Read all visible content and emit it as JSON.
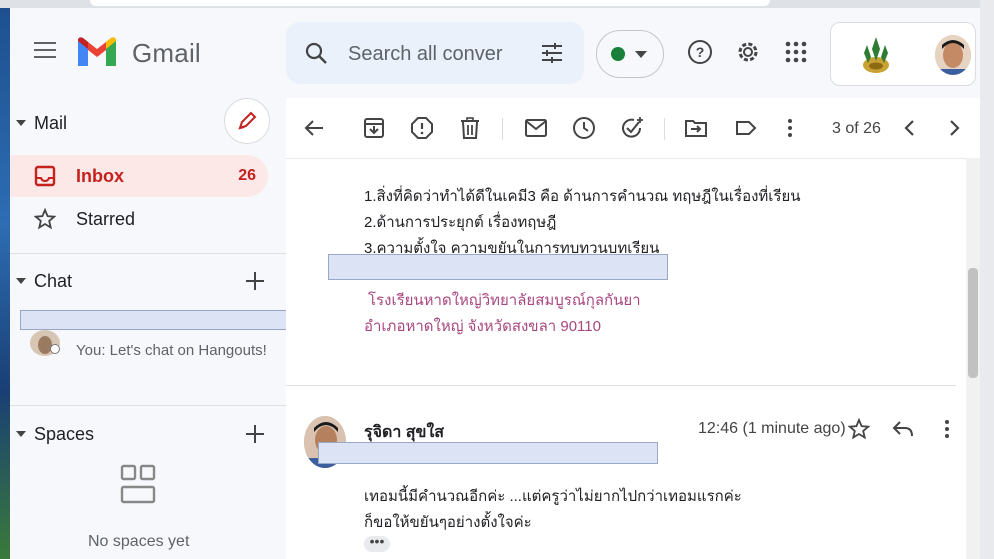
{
  "header": {
    "app_name": "Gmail",
    "search_placeholder": "Search all conver"
  },
  "nav": {
    "mail_title": "Mail",
    "items": [
      {
        "label": "Inbox",
        "count": "26"
      },
      {
        "label": "Starred"
      }
    ],
    "chat_title": "Chat",
    "chat_preview": "You: Let's chat on Hangouts!",
    "spaces_title": "Spaces",
    "spaces_empty": "No spaces yet"
  },
  "toolbar": {
    "pager": "3 of 26"
  },
  "message": {
    "lines": [
      "1.สิ่งที่คิดว่าทำได้ดีในเคมี3 คือ ด้านการคำนวณ ทฤษฎีในเรื่องที่เรียน",
      "2.ด้านการประยุกต์ เรื่องทฤษฎี",
      "3.ความตั้งใจ ความขยันในการทบทวนบทเรียน"
    ],
    "signature": [
      "โรงเรียนหาดใหญ่วิทยาลัยสมบูรณ์กุลกันยา",
      "อำเภอหาดใหญ่ จังหวัดสงขลา 90110"
    ]
  },
  "reply": {
    "sender": "รุจิดา สุขใส",
    "time": "12:46 (1 minute ago)",
    "lines": [
      "เทอมนี้มีคำนวณอีกค่ะ ...แต่ครูว่าไม่ยากไปกว่าเทอมแรกค่ะ",
      "ก็ขอให้ขยันๆอย่างตั้งใจค่ะ"
    ],
    "more": "•••"
  },
  "colors": {
    "accent_red": "#c5221f",
    "status_green": "#188038",
    "signature": "#a8477f"
  }
}
